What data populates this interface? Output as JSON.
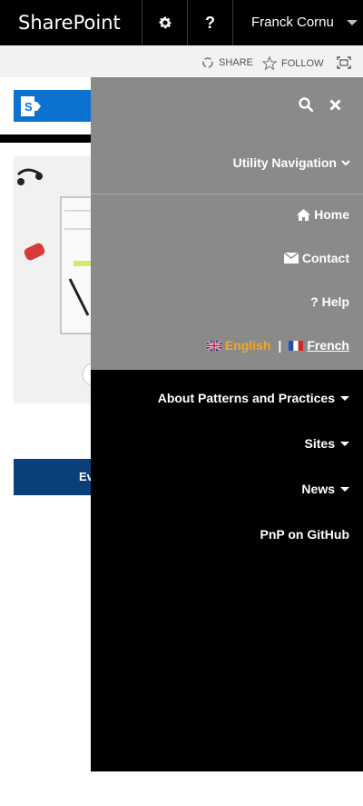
{
  "suitebar": {
    "brand": "SharePoint",
    "help_label": "?",
    "user_name": "Franck Cornu"
  },
  "ribbon": {
    "share_label": "SHARE",
    "follow_label": "FOLLOW"
  },
  "page": {
    "partial_button_label": "Ev"
  },
  "menu": {
    "utility_title": "Utility Navigation",
    "utility_items": [
      {
        "label": "Home",
        "icon": "home-icon"
      },
      {
        "label": "Contact",
        "icon": "envelope-icon"
      },
      {
        "label": "Help",
        "icon": "question-icon"
      }
    ],
    "languages": {
      "english": "English",
      "separator": "|",
      "french": "French"
    },
    "main_items": [
      {
        "label": "About Patterns and Practices",
        "has_dropdown": true
      },
      {
        "label": "Sites",
        "has_dropdown": true
      },
      {
        "label": "News",
        "has_dropdown": true
      },
      {
        "label": "PnP on GitHub",
        "has_dropdown": false
      }
    ]
  },
  "colors": {
    "suitebar_bg": "#000000",
    "menu_gray": "#8a8a8a",
    "menu_black": "#000000",
    "active_language": "#f5a623",
    "brand_blue": "#0b72d0"
  }
}
